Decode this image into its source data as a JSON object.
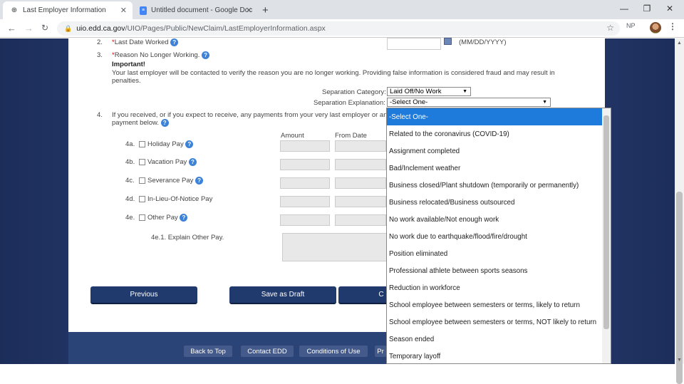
{
  "browser": {
    "tabs": [
      {
        "title": "Last Employer Information",
        "close": "✕"
      },
      {
        "title": "Untitled document - Google Doc",
        "close": "✕"
      }
    ],
    "new_tab": "+",
    "window": {
      "min": "—",
      "max": "❐",
      "close": "✕"
    },
    "url_host": "uio.edd.ca.gov",
    "url_path": "/UIO/Pages/Public/NewClaim/LastEmployerInformation.aspx",
    "ext_label": "NP"
  },
  "form": {
    "q2_num": "2.",
    "q2_star": "*",
    "q2_label": "Last Date Worked",
    "q2_format": "(MM/DD/YYYY)",
    "q3_num": "3.",
    "q3_star": "*",
    "q3_label": "Reason No Longer Working.",
    "important": "Important!",
    "warning_line1": "Your last employer will be contacted to verify the reason you are no longer working. Providing false information is considered fraud and may result in",
    "warning_line2": "penalties.",
    "sep_cat_label": "Separation Category:",
    "sep_cat_value": "Laid Off/No Work",
    "sep_exp_label": "Separation Explanation:",
    "sep_exp_value": "-Select One-",
    "q4_num": "4.",
    "q4_line1": "If you received, or if you expect to receive, any payments from your very last employer or any",
    "q4_line2": "payment below.",
    "col_amount": "Amount",
    "col_from": "From Date",
    "pay_rows": [
      {
        "id": "4a.",
        "label": "Holiday Pay"
      },
      {
        "id": "4b.",
        "label": "Vacation Pay"
      },
      {
        "id": "4c.",
        "label": "Severance Pay"
      },
      {
        "id": "4d.",
        "label": "In-Lieu-Of-Notice Pay"
      },
      {
        "id": "4e.",
        "label": "Other Pay"
      }
    ],
    "explain_other": "4e.1. Explain Other Pay."
  },
  "buttons": {
    "previous": "Previous",
    "save_draft": "Save as Draft",
    "continue_partial": "C"
  },
  "footer_links": [
    "Back to Top",
    "Contact EDD",
    "Conditions of Use",
    "Pr"
  ],
  "dropdown_options": [
    "-Select One-",
    "Related to the coronavirus (COVID-19)",
    "Assignment completed",
    "Bad/Inclement weather",
    "Business closed/Plant shutdown (temporarily or permanently)",
    "Business relocated/Business outsourced",
    "No work available/Not enough work",
    "No work due to earthquake/flood/fire/drought",
    "Position eliminated",
    "Professional athlete between sports seasons",
    "Reduction in workforce",
    "School employee between semesters or terms, likely to return",
    "School employee between semesters or terms, NOT likely to return",
    "Season ended",
    "Temporary layoff"
  ],
  "help_glyph": "?"
}
